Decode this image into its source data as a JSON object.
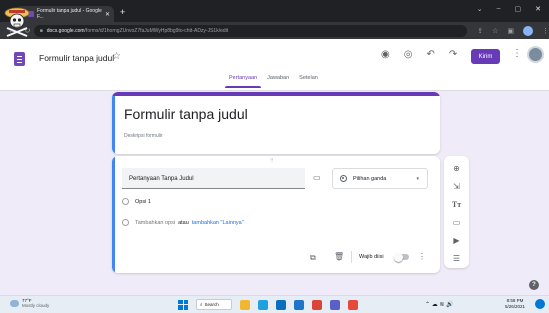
{
  "browser": {
    "tab_title": "Formulir tanpa judul - Google F...",
    "tab_close": "✕",
    "new_tab": "+",
    "window_controls": [
      "⌄",
      "–",
      "▢",
      "✕"
    ],
    "url_host": "docs.google.com",
    "url_path": "/forms/d/1horngZUnvoZ7faJuMWyHp8bg9to-chtt-ADzy-JS1k/edit",
    "nav": [
      "←",
      "↻"
    ],
    "addr_right_icons": [
      "share-icon",
      "star-icon",
      "extensions-icon",
      "profile-icon",
      "menu-icon"
    ],
    "addr_right_glyphs": [
      "⇪",
      "☆",
      "▣",
      "⋮"
    ]
  },
  "forms_header": {
    "doc_title": "Formulir tanpa judul",
    "star": "☆",
    "icons": [
      "palette-icon",
      "preview-icon",
      "undo-icon",
      "redo-icon"
    ],
    "icon_glyphs": [
      "◉",
      "◎",
      "↶",
      "↷"
    ],
    "send_label": "Kirim",
    "more": "⋮",
    "tabs": [
      "Pertanyaan",
      "Jawaban",
      "Setelan"
    ],
    "active_tab": 0
  },
  "title_card": {
    "title": "Formulir tanpa judul",
    "description": "Deskripsi formulir"
  },
  "question_card": {
    "drag_handle": "⠿",
    "question": "Pertanyaan Tanpa Judul",
    "image_glyph": "▭",
    "type": "Pilihan ganda",
    "type_caret": "▾",
    "option1": "Opsi 1",
    "add_option": "Tambahkan opsi",
    "or": "atau",
    "add_other": "tambahkan \"Lainnya\"",
    "copy_glyph": "⧉",
    "trash_glyph": "🗑",
    "required_label": "Wajib diisi",
    "more_glyph": "⋮"
  },
  "sidebar": {
    "items": [
      {
        "name": "add-question-icon",
        "glyph": "⊕"
      },
      {
        "name": "import-questions-icon",
        "glyph": "⇲"
      },
      {
        "name": "add-title-icon",
        "glyph": "Tт"
      },
      {
        "name": "add-image-icon",
        "glyph": "▭"
      },
      {
        "name": "add-video-icon",
        "glyph": "▶"
      },
      {
        "name": "add-section-icon",
        "glyph": "☰"
      }
    ]
  },
  "help": "?",
  "taskbar": {
    "temp": "77°F",
    "condition": "Mostly cloudy",
    "search_label": "Search",
    "tray": "⌃  ☁  ≋  🔊",
    "time": "8:58 PM",
    "date": "5/26/2021",
    "apps": [
      {
        "name": "file-explorer-icon",
        "color": "#f2b632"
      },
      {
        "name": "edge-icon",
        "color": "#1fa0e0"
      },
      {
        "name": "store-icon",
        "color": "#0b6fbf"
      },
      {
        "name": "mail-icon",
        "color": "#1d74c8"
      },
      {
        "name": "chrome-icon",
        "color": "#db4437"
      },
      {
        "name": "teams-icon",
        "color": "#5b5fc7"
      },
      {
        "name": "app-red-icon",
        "color": "#e54b3c"
      }
    ]
  },
  "colors": {
    "accent": "#673ab7",
    "focus": "#4285f4",
    "background": "#f0ebf8"
  }
}
